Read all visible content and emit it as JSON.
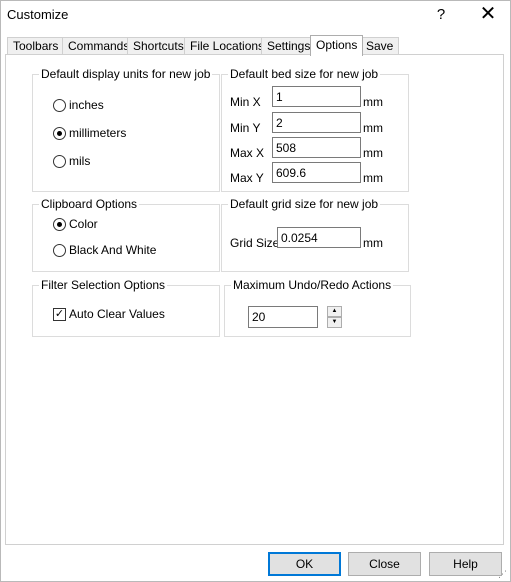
{
  "window": {
    "title": "Customize",
    "help_glyph": "?",
    "close_glyph": "✕"
  },
  "tabs": [
    {
      "label": "Toolbars"
    },
    {
      "label": "Commands"
    },
    {
      "label": "Shortcuts"
    },
    {
      "label": "File Locations"
    },
    {
      "label": "Settings"
    },
    {
      "label": "Options",
      "active": true
    },
    {
      "label": "Save"
    }
  ],
  "units_group": {
    "title": "Default display units for new job",
    "options": [
      {
        "label": "inches",
        "checked": false
      },
      {
        "label": "millimeters",
        "checked": true
      },
      {
        "label": "mils",
        "checked": false
      }
    ]
  },
  "bed_group": {
    "title": "Default bed size for new job",
    "fields": [
      {
        "label": "Min X",
        "value": "1",
        "unit": "mm"
      },
      {
        "label": "Min Y",
        "value": "2",
        "unit": "mm"
      },
      {
        "label": "Max X",
        "value": "508",
        "unit": "mm"
      },
      {
        "label": "Max Y",
        "value": "609.6",
        "unit": "mm"
      }
    ]
  },
  "clipboard_group": {
    "title": "Clipboard Options",
    "options": [
      {
        "label": "Color",
        "checked": true
      },
      {
        "label": "Black And White",
        "checked": false
      }
    ]
  },
  "grid_group": {
    "title": "Default grid size for new job",
    "label": "Grid Size",
    "value": "0.0254",
    "unit": "mm"
  },
  "filter_group": {
    "title": "Filter Selection Options",
    "checkbox_label": "Auto Clear Values",
    "checked": true,
    "check_glyph": "✓"
  },
  "undo_group": {
    "title": "Maximum Undo/Redo Actions",
    "value": "20",
    "up_glyph": "▲",
    "down_glyph": "▼"
  },
  "buttons": {
    "ok": "OK",
    "close": "Close",
    "help": "Help"
  },
  "resize_grip": "⋰"
}
